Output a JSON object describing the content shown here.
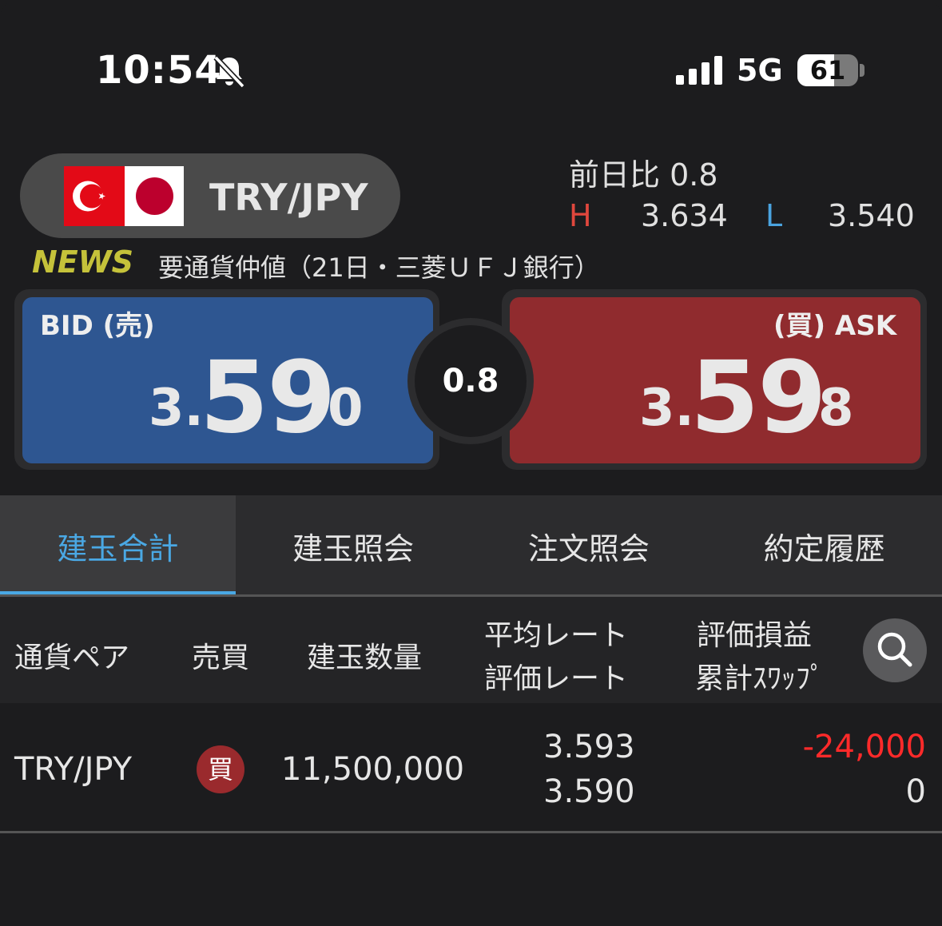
{
  "status_bar": {
    "time": "10:54",
    "network": "5G",
    "battery": "61",
    "battery_level": 0.61,
    "icons": [
      "bell-slash-icon",
      "signal-bars-icon",
      "battery-icon"
    ]
  },
  "header": {
    "pair": "TRY/JPY",
    "flags": [
      "turkey-flag",
      "japan-flag"
    ],
    "change": "前日比 0.8",
    "high_label": "H",
    "high": "3.634",
    "low_label": "L",
    "low": "3.540"
  },
  "news": {
    "tag": "NEWS",
    "text": "要通貨仲値（21日・三菱ＵＦＪ銀行）"
  },
  "quote": {
    "bid_label": "BID (売)",
    "bid_prefix": "3.",
    "bid_main": "59",
    "bid_suffix": "0",
    "spread": "0.8",
    "ask_label": "(買) ASK",
    "ask_prefix": "3.",
    "ask_main": "59",
    "ask_suffix": "8"
  },
  "tabs": [
    "建玉合計",
    "建玉照会",
    "注文照会",
    "約定履歴"
  ],
  "active_tab": 0,
  "table": {
    "headers": {
      "pair": "通貨ペア",
      "side": "売買",
      "quantity": "建玉数量",
      "avg_rate": "平均レート",
      "eval_rate": "評価レート",
      "pnl": "評価損益",
      "swap": "累計ｽﾜｯﾌﾟ"
    },
    "rows": [
      {
        "pair": "TRY/JPY",
        "side": "買",
        "quantity": "11,500,000",
        "avg_rate": "3.593",
        "eval_rate": "3.590",
        "pnl": "-24,000",
        "swap": "0"
      }
    ]
  },
  "colors": {
    "bid": "#2e5691",
    "ask": "#902b2e",
    "accent": "#4aa8e4",
    "loss": "#ff2a2a",
    "news": "#c5c23a"
  }
}
